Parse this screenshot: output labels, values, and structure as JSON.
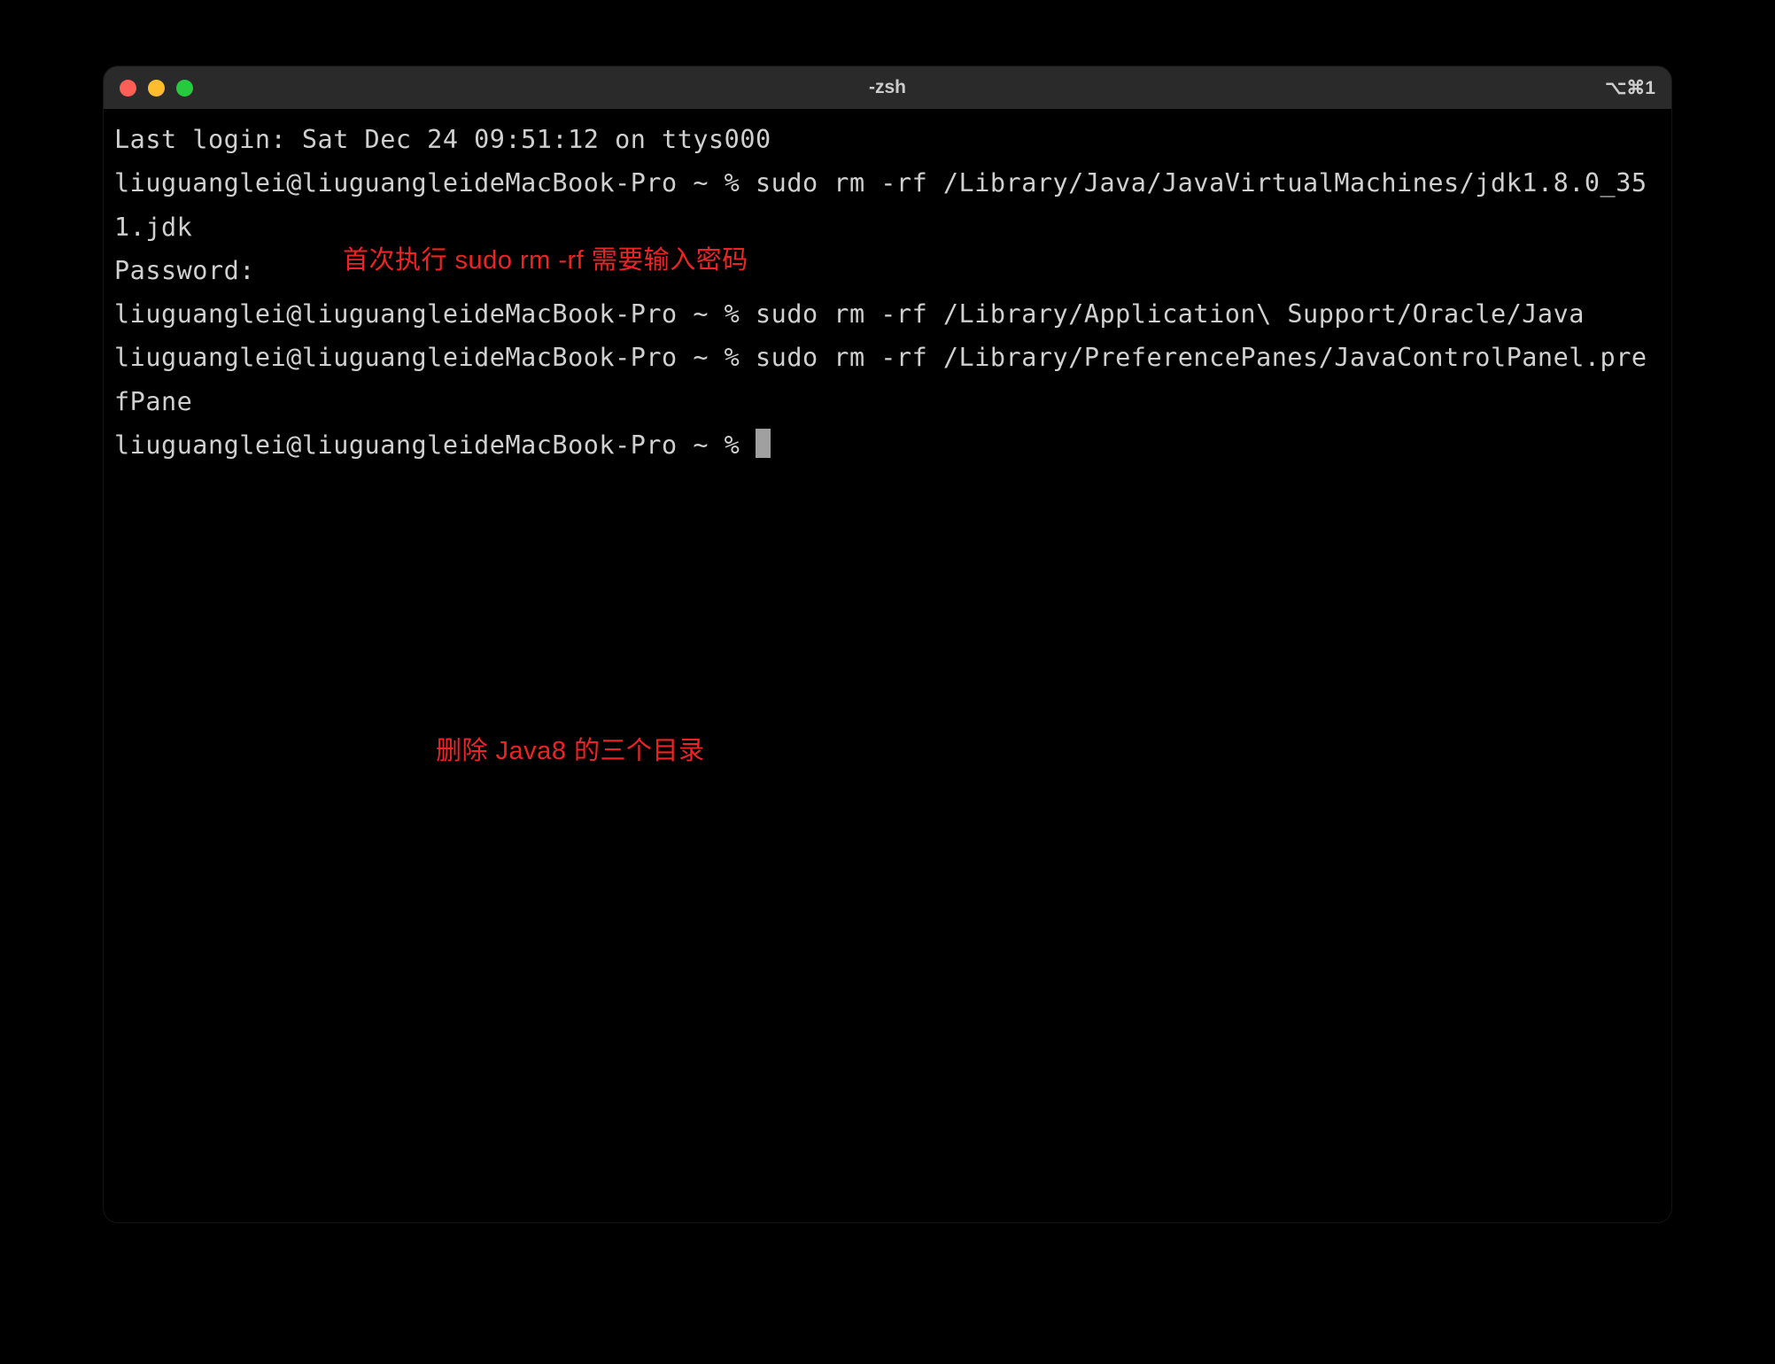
{
  "window": {
    "title": "-zsh",
    "shortcut": "⌥⌘1"
  },
  "terminal": {
    "last_login": "Last login: Sat Dec 24 09:51:12 on ttys000",
    "prompt1": "liuguanglei@liuguangleideMacBook-Pro ~ % ",
    "command1": "sudo rm -rf /Library/Java/JavaVirtualMachines/jdk1.8.0_351.jdk",
    "password_prompt": "Password:",
    "prompt2": "liuguanglei@liuguangleideMacBook-Pro ~ % ",
    "command2": "sudo rm -rf /Library/Application\\ Support/Oracle/Java",
    "prompt3": "liuguanglei@liuguangleideMacBook-Pro ~ % ",
    "command3": "sudo rm -rf /Library/PreferencePanes/JavaControlPanel.prefPane",
    "prompt4": "liuguanglei@liuguangleideMacBook-Pro ~ % "
  },
  "annotations": {
    "password_note": "首次执行 sudo rm -rf 需要输入密码",
    "delete_note": "删除 Java8 的三个目录"
  }
}
